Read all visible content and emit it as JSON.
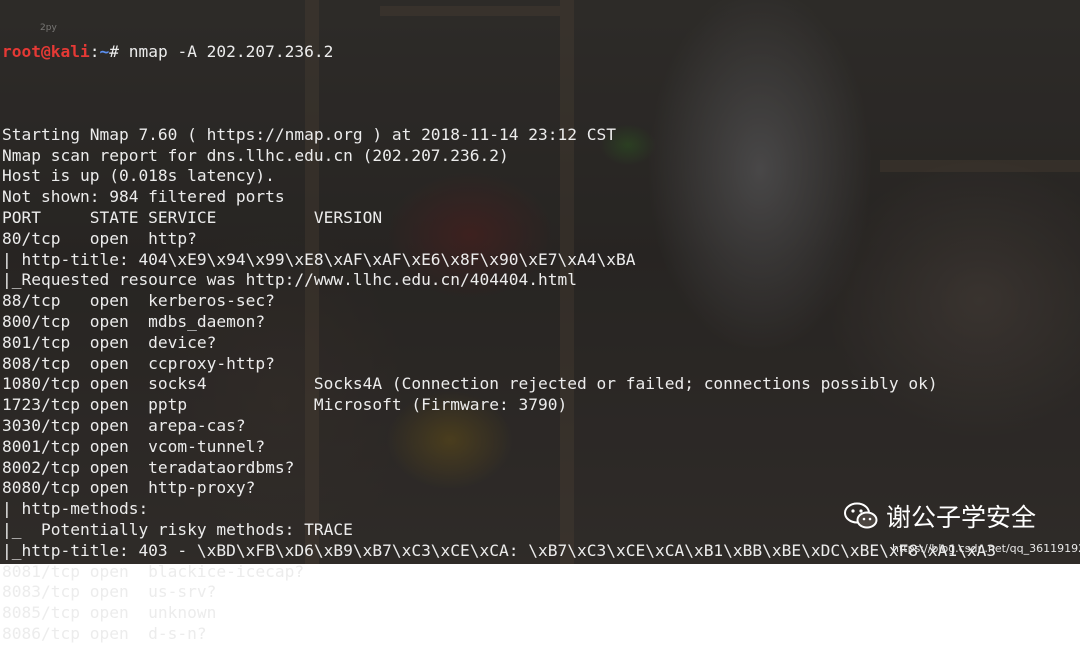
{
  "terminal": {
    "prompt_user_host": "root@kali",
    "prompt_sep": ":",
    "prompt_path": "~",
    "prompt_symbol": "# ",
    "command": "nmap -A 202.207.236.2",
    "lines": [
      "",
      "Starting Nmap 7.60 ( https://nmap.org ) at 2018-11-14 23:12 CST",
      "Nmap scan report for dns.llhc.edu.cn (202.207.236.2)",
      "Host is up (0.018s latency).",
      "Not shown: 984 filtered ports",
      "PORT     STATE SERVICE          VERSION",
      "80/tcp   open  http?",
      "| http-title: 404\\xE9\\x94\\x99\\xE8\\xAF\\xAF\\xE6\\x8F\\x90\\xE7\\xA4\\xBA",
      "|_Requested resource was http://www.llhc.edu.cn/404404.html",
      "88/tcp   open  kerberos-sec?",
      "800/tcp  open  mdbs_daemon?",
      "801/tcp  open  device?",
      "808/tcp  open  ccproxy-http?",
      "1080/tcp open  socks4           Socks4A (Connection rejected or failed; connections possibly ok)",
      "1723/tcp open  pptp             Microsoft (Firmware: 3790)",
      "3030/tcp open  arepa-cas?",
      "8001/tcp open  vcom-tunnel?",
      "8002/tcp open  teradataordbms?",
      "8080/tcp open  http-proxy?",
      "| http-methods:",
      "|_  Potentially risky methods: TRACE",
      "|_http-title: 403 - \\xBD\\xFB\\xD6\\xB9\\xB7\\xC3\\xCE\\xCA: \\xB7\\xC3\\xCE\\xCA\\xB1\\xBB\\xBE\\xDC\\xBE\\xF8\\xA1\\xA3",
      "8081/tcp open  blackice-icecap?",
      "8083/tcp open  us-srv?",
      "8085/tcp open  unknown",
      "8086/tcp open  d-s-n?"
    ]
  },
  "watermark": {
    "name": "谢公子学安全",
    "url": "https://blog.csdn.net/qq_36119192",
    "tiny": "2py"
  },
  "colors": {
    "prompt_user": "#e53935",
    "prompt_path": "#5b8ff0",
    "text": "#ececec"
  },
  "icons": {
    "watermark_logo": "wechat-icon"
  }
}
